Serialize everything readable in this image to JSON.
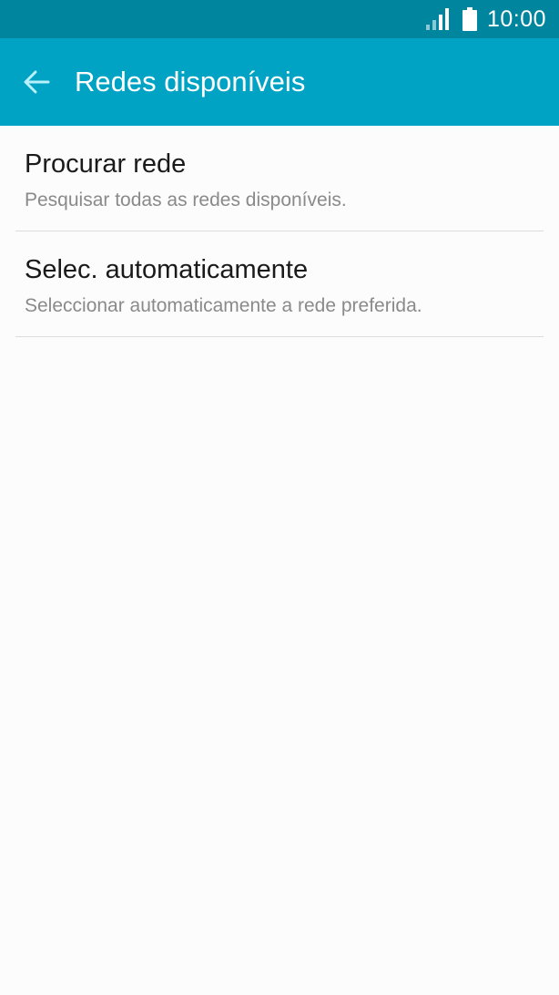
{
  "status_bar": {
    "time": "10:00",
    "signal_icon": "signal-strength-icon",
    "battery_icon": "battery-icon"
  },
  "app_bar": {
    "back_icon": "arrow-left-icon",
    "title": "Redes disponíveis"
  },
  "list": {
    "items": [
      {
        "title": "Procurar rede",
        "summary": "Pesquisar todas as redes disponíveis."
      },
      {
        "title": "Selec. automaticamente",
        "summary": "Seleccionar automaticamente a rede preferida."
      }
    ]
  },
  "colors": {
    "status_bar": "#00859e",
    "app_bar": "#00a3c4",
    "back_arrow": "#b8f0fb",
    "background": "#fcfcfc",
    "divider": "#dcdcdc",
    "title_text": "#1a1a1a",
    "summary_text": "#8a8a8a"
  }
}
